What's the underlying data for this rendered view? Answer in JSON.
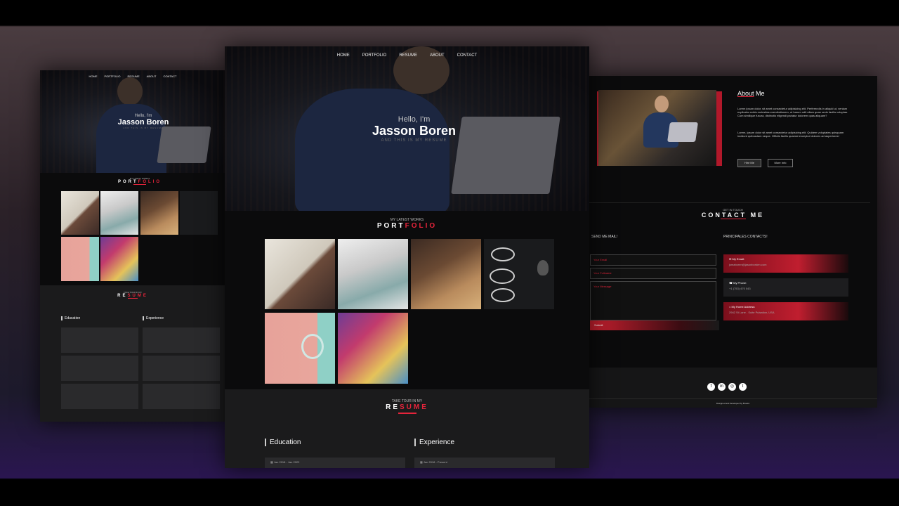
{
  "nav": {
    "home": "HOME",
    "portfolio": "PORTFOLIO",
    "resume": "RESUME",
    "about": "ABOUT",
    "contact": "CONTACT"
  },
  "hero": {
    "greeting": "Hello, I'm",
    "name": "Jasson Boren",
    "tagline": "AND THIS IS MY RESUME"
  },
  "portfolio": {
    "kicker": "MY LATEST WORKS",
    "title_main": "PORT",
    "title_accent": "FOLIO"
  },
  "resume": {
    "kicker": "TAKE TOUR IN MY",
    "title_main": "RE",
    "title_accent": "SUME",
    "education_title": "Education",
    "experience_title": "Experience",
    "edu_date": "Jan 2018 - Jan 2022",
    "exp_date": "Jan 2018 - Present"
  },
  "about": {
    "title_main": "About",
    "title_accent": "Me",
    "p1": "Lorem ipsum dolor, sit amet consectetur adipisicing elit. Perferendis in aliquid ut, veniam explicabo nobis molestias exercitationem, ut harum odit ullam quae unde facilis voluptas. Cum similique fusura, distinctio eligendi pariatur dolorem quas aliquam?",
    "p2": "Lorem, ipsum dolor sit amet consectetur adipisicing elit. Quidem voluptates quisquam incidunt quibusdam neque. Officiis facilis quaerat excepturi dolores ad asperiores!",
    "btn_hire": "Hire Me",
    "btn_more": "More Info"
  },
  "contact": {
    "kicker": "GET IN TOUCH",
    "title": "CONTACT ME",
    "send_title": "SEND ME MAIL!",
    "principal_title": "PRINCIPALES CONTACTS!",
    "email_ph": "Your Email",
    "fullname_ph": "Your Fullname",
    "message_ph": "Your Message",
    "submit": "Submit",
    "email_label": "My Email:",
    "email_value": "jsmaboren@jasonborden.com",
    "phone_label": "My Phone:",
    "phone_value": "+1 (753) 470 043",
    "address_label": "My Home Address:",
    "address_value": "2942 St Lane - Suite Pulsation, USA",
    "footer": "Designed and developed by Brooks"
  },
  "colors": {
    "accent": "#e5243b",
    "background": "#0b0b0c",
    "resume_bg": "#1b1b1c"
  }
}
